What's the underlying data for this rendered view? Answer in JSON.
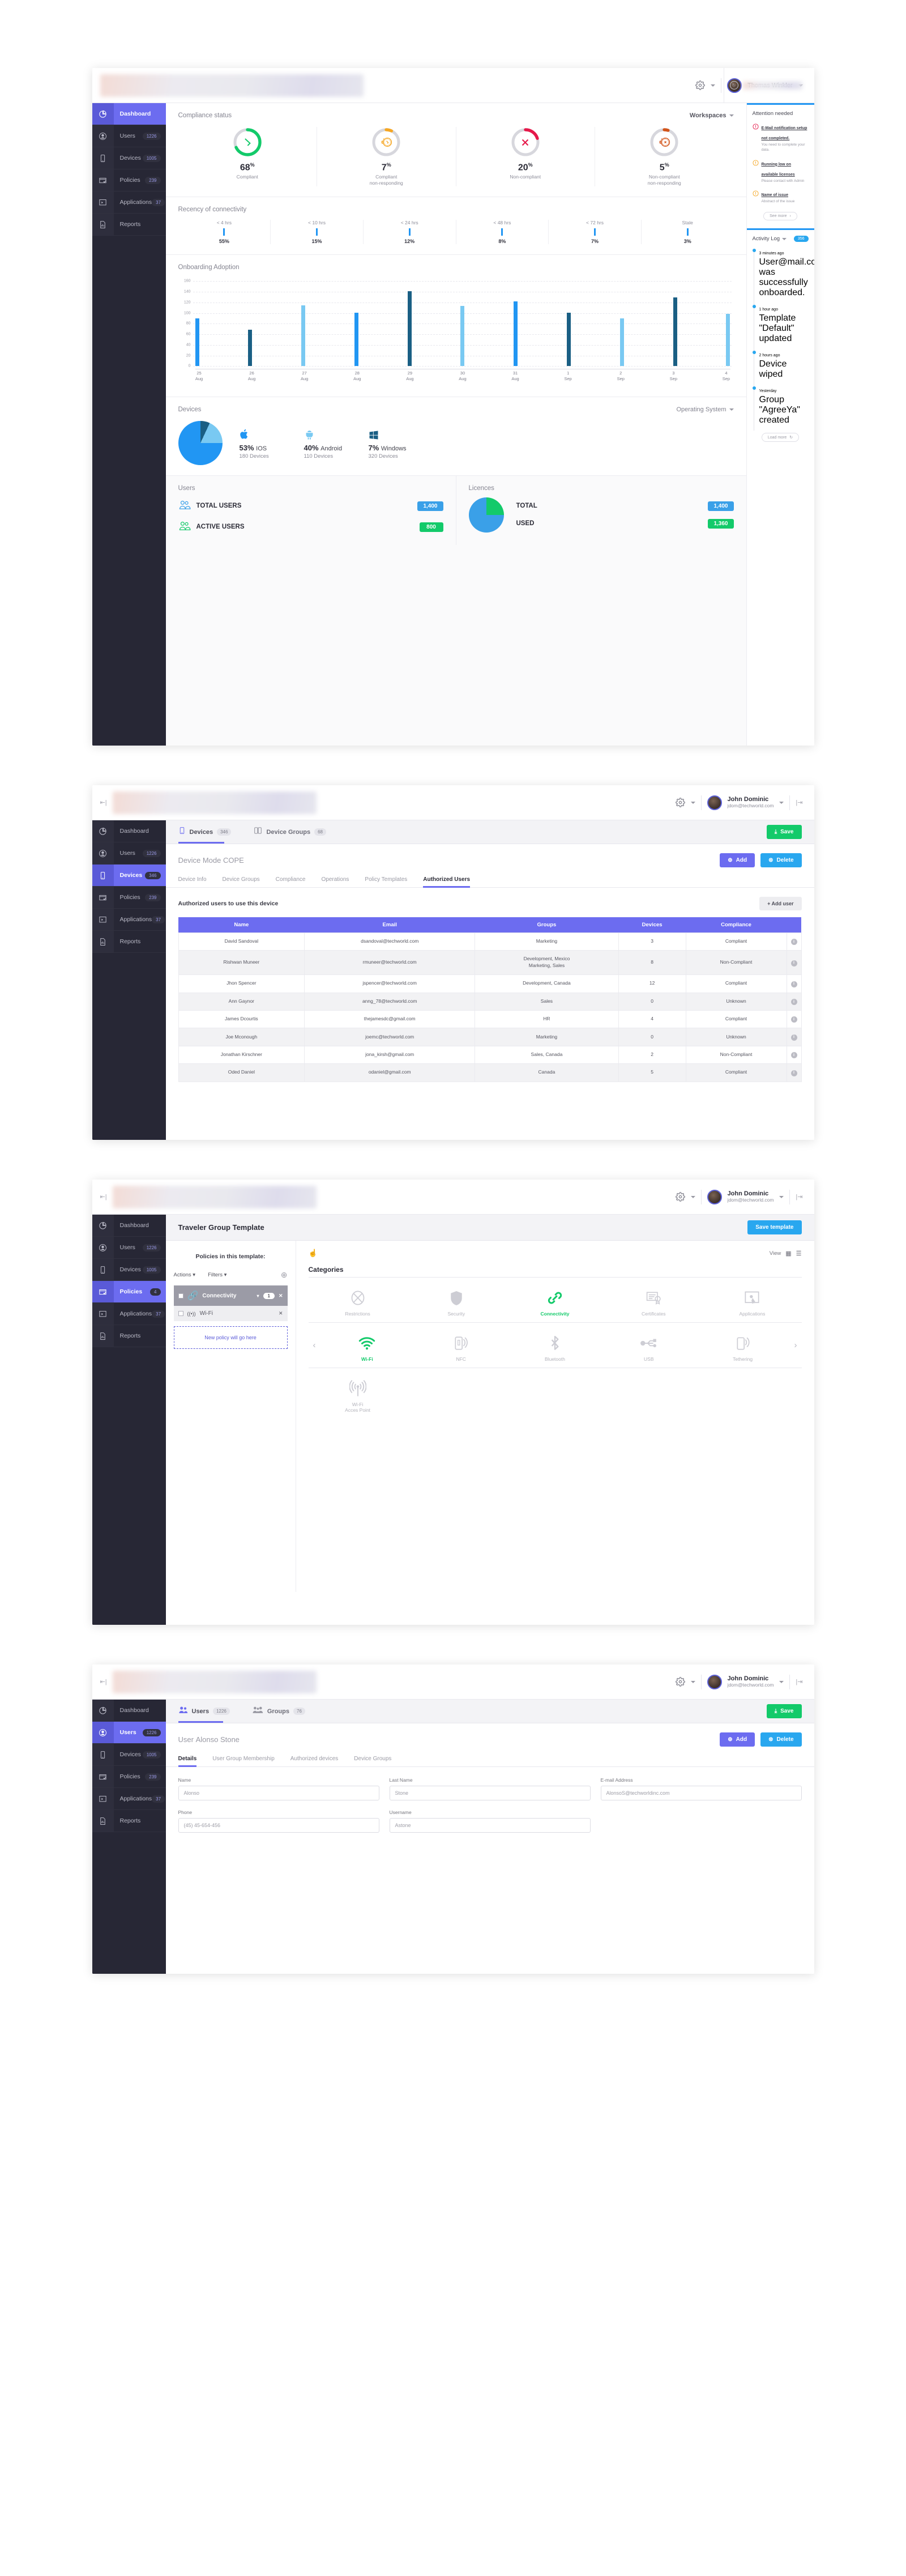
{
  "brand": {
    "purple": "#6c6cf0",
    "blue": "#29a7ef",
    "green": "#13ca6a",
    "red": "#e5194a",
    "orange": "#f5a623",
    "dark_orange": "#d2541a",
    "sidebar": "#272735"
  },
  "screen1": {
    "user": {
      "name": "Thomas Winkler"
    },
    "sidebar": [
      {
        "label": "Dashboard",
        "count": "",
        "icon": "pie-chart-icon"
      },
      {
        "label": "Users",
        "count": "1226",
        "icon": "user-icon"
      },
      {
        "label": "Devices",
        "count": "1005",
        "icon": "phone-icon"
      },
      {
        "label": "Policies",
        "count": "239",
        "icon": "policy-icon"
      },
      {
        "label": "Applications",
        "count": "37",
        "icon": "app-icon"
      },
      {
        "label": "Reports",
        "count": "",
        "icon": "report-icon"
      }
    ],
    "compliance": {
      "title": "Compliance status",
      "workspaces": "Workspaces",
      "items": [
        {
          "pct": "68",
          "unit": "%",
          "label": "Compliant",
          "value": 68,
          "color": "#13ca6a",
          "icon": "check-icon"
        },
        {
          "pct": "7",
          "unit": "%",
          "label": "Compliant\nnon-responding",
          "value": 7,
          "color": "#f5a623",
          "icon": "stopwatch-check-icon"
        },
        {
          "pct": "20",
          "unit": "%",
          "label": "Non-compliant",
          "value": 20,
          "color": "#e5194a",
          "icon": "cross-icon"
        },
        {
          "pct": "5",
          "unit": "%",
          "label": "Non-compliant\nnon-responding",
          "value": 5,
          "color": "#d2541a",
          "icon": "stopwatch-cross-icon"
        }
      ]
    },
    "recency": {
      "title": "Recency of connectivity",
      "items": [
        {
          "range": "< 4 hrs",
          "value": "55%"
        },
        {
          "range": "< 10 hrs",
          "value": "15%"
        },
        {
          "range": "< 24 hrs",
          "value": "12%"
        },
        {
          "range": "< 48 hrs",
          "value": "8%"
        },
        {
          "range": "< 72 hrs",
          "value": "7%"
        },
        {
          "range": "Stale",
          "value": "3%"
        }
      ]
    },
    "onboarding": {
      "title": "Onboarding Adoption"
    },
    "devices": {
      "title": "Devices",
      "os_selector": "Operating System",
      "items": [
        {
          "pct": "53%",
          "name": "IOS",
          "devices": "180 Devices",
          "icon": "apple-icon",
          "color": "#2196f3"
        },
        {
          "pct": "40%",
          "name": "Android",
          "devices": "110 Devices",
          "icon": "android-icon",
          "color": "#79c9f2"
        },
        {
          "pct": "7%",
          "name": "Windows",
          "devices": "320 Devices",
          "icon": "windows-icon",
          "color": "#1a5f84"
        }
      ]
    },
    "users_card": {
      "title": "Users",
      "rows": [
        {
          "label": "TOTAL USERS",
          "value": "1,400",
          "color": "#3aa0e8"
        },
        {
          "label": "ACTIVE USERS",
          "value": "800",
          "color": "#13ca6a"
        }
      ]
    },
    "licences_card": {
      "title": "Licences",
      "rows": [
        {
          "label": "TOTAL",
          "value": "1,400",
          "color": "#3aa0e8"
        },
        {
          "label": "USED",
          "value": "1,360",
          "color": "#13ca6a"
        }
      ]
    },
    "attention": {
      "title": "Attention needed",
      "items": [
        {
          "title": "E-Mail notification setup not completed.",
          "desc": "You need to complete your data.",
          "severity": "#e5194a"
        },
        {
          "title": "Running low on available licenses",
          "desc": "Please contact with Admin",
          "severity": "#f5a623"
        },
        {
          "title": "Name of issue",
          "desc": "Abstract of the issue",
          "severity": "#f5a623"
        }
      ],
      "see_more": "See more"
    },
    "activity": {
      "title": "Activity Log",
      "count": "356",
      "items": [
        {
          "time": "3 minutes ago",
          "desc": "User@mail.com was successfully onboarded."
        },
        {
          "time": "1 hour ago",
          "desc": "Template \"Default\" updated"
        },
        {
          "time": "2 hours ago",
          "desc": "Device wiped"
        },
        {
          "time": "Yesterday",
          "desc": "Group \"AgreeYa\" created"
        }
      ],
      "load_more": "Load more"
    }
  },
  "chart_data": {
    "type": "bar",
    "title": "Onboarding Adoption",
    "categories": [
      "25 Aug",
      "26 Aug",
      "27 Aug",
      "28 Aug",
      "29 Aug",
      "30 Aug",
      "31 Aug",
      "1 Sep",
      "2 Sep",
      "3 Sep",
      "4 Sep"
    ],
    "tick_day": [
      "25",
      "26",
      "27",
      "28",
      "29",
      "30",
      "31",
      "1",
      "2",
      "3",
      "4"
    ],
    "tick_month": [
      "Aug",
      "Aug",
      "Aug",
      "Aug",
      "Aug",
      "Aug",
      "Aug",
      "Sep",
      "Sep",
      "Sep",
      "Sep"
    ],
    "values": [
      90,
      69,
      115,
      101,
      141,
      113,
      122,
      101,
      90,
      129,
      99
    ],
    "colors": [
      "#2196f3",
      "#1a5f84",
      "#79c9f2",
      "#2196f3",
      "#1a5f84",
      "#79c9f2",
      "#2196f3",
      "#1a5f84",
      "#79c9f2",
      "#1a5f84",
      "#79c9f2"
    ],
    "yticks": [
      0,
      20,
      40,
      60,
      80,
      100,
      120,
      140,
      160
    ],
    "ylim": [
      0,
      160
    ],
    "xlabel": "",
    "ylabel": "",
    "grid": true,
    "legend": "none"
  },
  "screen2": {
    "user": {
      "name": "John Dominic",
      "email": "jdom@techworld.com"
    },
    "sidebar": [
      {
        "label": "Dashboard",
        "count": "",
        "icon": "pie-chart-icon"
      },
      {
        "label": "Users",
        "count": "1226",
        "icon": "user-icon"
      },
      {
        "label": "Devices",
        "count": "346",
        "icon": "phone-icon"
      },
      {
        "label": "Policies",
        "count": "239",
        "icon": "policy-icon"
      },
      {
        "label": "Applications",
        "count": "37",
        "icon": "app-icon"
      },
      {
        "label": "Reports",
        "count": "",
        "icon": "report-icon"
      }
    ],
    "tabs": [
      {
        "label": "Devices",
        "count": "346",
        "icon": "phone-icon",
        "active": true
      },
      {
        "label": "Device Groups",
        "count": "68",
        "icon": "device-group-icon",
        "active": false
      }
    ],
    "save_label": "Save",
    "page_title": "Device Mode",
    "page_subtitle": "COPE",
    "add_label": "Add",
    "delete_label": "Delete",
    "subtabs": [
      "Device Info",
      "Device Groups",
      "Compliance",
      "Operations",
      "Policy Templates",
      "Authorized Users"
    ],
    "active_subtab": "Authorized Users",
    "table_caption": "Authorized users to use this device",
    "add_user_label": "+ Add user",
    "columns": [
      "Name",
      "Email",
      "Groups",
      "Devices",
      "Compliance",
      ""
    ],
    "rows": [
      {
        "name": "David Sandoval",
        "email": "dsandoval@techworld.com",
        "groups": "Marketing",
        "devices": "3",
        "compliance": "Compliant"
      },
      {
        "name": "Rishwan Muneer",
        "email": "rmuneer@techworld.com",
        "groups": "Development, Mexico\nMarketing, Sales",
        "devices": "8",
        "compliance": "Non-Compliant"
      },
      {
        "name": "Jhon Spencer",
        "email": "jspencer@techworld.com",
        "groups": "Development, Canada",
        "devices": "12",
        "compliance": "Compliant"
      },
      {
        "name": "Ann Gaynor",
        "email": "anng_78@techworld.com",
        "groups": "Sales",
        "devices": "0",
        "compliance": "Unknown"
      },
      {
        "name": "James Dcourtis",
        "email": "thejamesdc@gmail.com",
        "groups": "HR",
        "devices": "4",
        "compliance": "Compliant"
      },
      {
        "name": "Joe Mconough",
        "email": "joemc@techworld.com",
        "groups": "Marketing",
        "devices": "0",
        "compliance": "Unknown"
      },
      {
        "name": "Jonathan Kirschner",
        "email": "jona_kirsh@gmail.com",
        "groups": "Sales, Canada",
        "devices": "2",
        "compliance": "Non-Compliant"
      },
      {
        "name": "Oded Daniel",
        "email": "odaniel@gmail.com",
        "groups": "Canada",
        "devices": "5",
        "compliance": "Compliant"
      }
    ]
  },
  "screen3": {
    "user": {
      "name": "John Dominic",
      "email": "jdom@techworld.com"
    },
    "sidebar": [
      {
        "label": "Dashboard",
        "count": "",
        "icon": "pie-chart-icon"
      },
      {
        "label": "Users",
        "count": "1226",
        "icon": "user-icon"
      },
      {
        "label": "Devices",
        "count": "1005",
        "icon": "phone-icon"
      },
      {
        "label": "Policies",
        "count": "4",
        "icon": "policy-icon"
      },
      {
        "label": "Applications",
        "count": "37",
        "icon": "app-icon"
      },
      {
        "label": "Reports",
        "count": "",
        "icon": "report-icon"
      }
    ],
    "title": "Traveler Group Template",
    "save_label": "Save template",
    "left_title": "Policies in this template:",
    "actions_label": "Actions",
    "filters_label": "Filters",
    "policies": [
      {
        "label": "Connectivity",
        "count": "1",
        "selected": true,
        "icon": "link-icon"
      },
      {
        "label": "Wi-Fi",
        "count": "",
        "selected": false,
        "icon": "wifi-icon"
      }
    ],
    "drop_hint": "New policy will go here",
    "view_label": "View",
    "categories_title": "Categories",
    "categories": [
      {
        "label": "Restrictions",
        "icon": "restrictions-icon",
        "active": false
      },
      {
        "label": "Security",
        "icon": "shield-icon",
        "active": false
      },
      {
        "label": "Connectivity",
        "icon": "link-icon",
        "active": true
      },
      {
        "label": "Certificates",
        "icon": "certificate-icon",
        "active": false
      },
      {
        "label": "Applications",
        "icon": "app-icon",
        "active": false
      }
    ],
    "subcategories": [
      {
        "label": "Wi-Fi",
        "icon": "wifi-icon",
        "active": true
      },
      {
        "label": "NFC",
        "icon": "nfc-icon",
        "active": false
      },
      {
        "label": "Bluetooth",
        "icon": "bluetooth-icon",
        "active": false
      },
      {
        "label": "USB",
        "icon": "usb-icon",
        "active": false
      },
      {
        "label": "Tethering",
        "icon": "tethering-icon",
        "active": false
      }
    ],
    "third_row": [
      {
        "label": "Wi-Fi\nAcces Point",
        "icon": "wifi-access-point-icon",
        "active": false
      }
    ]
  },
  "screen4": {
    "user": {
      "name": "John Dominic",
      "email": "jdom@techworld.com"
    },
    "sidebar": [
      {
        "label": "Dashboard",
        "count": "",
        "icon": "pie-chart-icon"
      },
      {
        "label": "Users",
        "count": "1226",
        "icon": "user-icon"
      },
      {
        "label": "Devices",
        "count": "1005",
        "icon": "phone-icon"
      },
      {
        "label": "Policies",
        "count": "239",
        "icon": "policy-icon"
      },
      {
        "label": "Applications",
        "count": "37",
        "icon": "app-icon"
      },
      {
        "label": "Reports",
        "count": "",
        "icon": "report-icon"
      }
    ],
    "tabs": [
      {
        "label": "Users",
        "count": "1226",
        "icon": "user-icon",
        "active": true
      },
      {
        "label": "Groups",
        "count": "76",
        "icon": "group-icon",
        "active": false
      }
    ],
    "save_label": "Save",
    "page_title": "User",
    "page_subtitle": "Alonso Stone",
    "add_label": "Add",
    "delete_label": "Delete",
    "subtabs": [
      "Details",
      "User Group Membership",
      "Authorized devices",
      "Device Groups"
    ],
    "active_subtab": "Details",
    "fields": [
      {
        "label": "Name",
        "value": "Alonso"
      },
      {
        "label": "Last Name",
        "value": "Stone"
      },
      {
        "label": "E-mail Address",
        "value": "AlonsoS@techworldinc.com"
      },
      {
        "label": "Phone",
        "value": "(45) 45-654-456"
      },
      {
        "label": "Username",
        "value": "Astone"
      }
    ]
  }
}
